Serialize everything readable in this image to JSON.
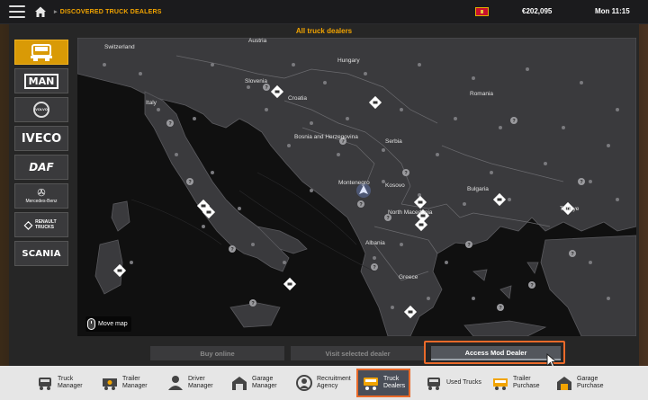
{
  "topbar": {
    "breadcrumb": "DISCOVERED TRUCK DEALERS",
    "money": "€202,095",
    "time": "Mon 11:15"
  },
  "panel": {
    "title": "All truck dealers"
  },
  "brands": [
    {
      "id": "truck-generic",
      "label": ""
    },
    {
      "id": "man",
      "label": "MAN"
    },
    {
      "id": "volvo",
      "label": "VOLVO"
    },
    {
      "id": "iveco",
      "label": "IVECO"
    },
    {
      "id": "daf",
      "label": "DAF"
    },
    {
      "id": "mercedes",
      "label": "Mercedes-Benz"
    },
    {
      "id": "renault",
      "label": "RENAULT TRUCKS"
    },
    {
      "id": "scania",
      "label": "SCANIA"
    }
  ],
  "map": {
    "countries": [
      "Switzerland",
      "Austria",
      "Hungary",
      "Slovenia",
      "Croatia",
      "Romania",
      "Italy",
      "Bosnia and Herzegovina",
      "Serbia",
      "Montenegro",
      "Kosovo",
      "Bulgaria",
      "North Macedonia",
      "Türkiye",
      "Albania",
      "Greece"
    ],
    "move_map_label": "Move map"
  },
  "actions": {
    "buy_online": "Buy online",
    "visit_selected": "Visit selected dealer",
    "access_mod": "Access Mod Dealer"
  },
  "bottombar": {
    "tabs": [
      {
        "line1": "Truck",
        "line2": "Manager"
      },
      {
        "line1": "Trailer",
        "line2": "Manager"
      },
      {
        "line1": "Driver",
        "line2": "Manager"
      },
      {
        "line1": "Garage",
        "line2": "Manager"
      },
      {
        "line1": "Recruitment",
        "line2": "Agency"
      },
      {
        "line1": "Truck",
        "line2": "Dealers"
      },
      {
        "line1": "Used Trucks",
        "line2": ""
      },
      {
        "line1": "Trailer",
        "line2": "Purchase"
      },
      {
        "line1": "Garage",
        "line2": "Purchase"
      }
    ]
  },
  "colors": {
    "accent": "#f2a400",
    "active_brand": "#d99a06",
    "highlight": "#ea6a2a"
  }
}
